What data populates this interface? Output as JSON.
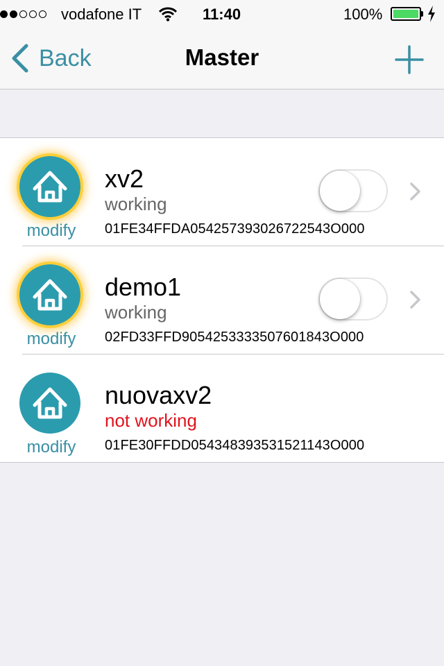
{
  "status_bar": {
    "signal_dots": [
      true,
      true,
      false,
      false,
      false
    ],
    "carrier": "vodafone IT",
    "time": "11:40",
    "battery": "100%"
  },
  "nav": {
    "back_label": "Back",
    "title": "Master"
  },
  "colors": {
    "accent": "#3a8fa3",
    "avatar": "#2b9cae",
    "error": "#e0141e",
    "glow": "#ffcf3a"
  },
  "devices": [
    {
      "name": "xv2",
      "status": "working",
      "serial": "01FE34FFDA054257393026722543O000",
      "modify_label": "modify",
      "icon": "home-icon",
      "highlighted": true,
      "toggle_on": false,
      "has_toggle": true
    },
    {
      "name": "demo1",
      "status": "working",
      "serial": "02FD33FFD9054253333507601843O000",
      "modify_label": "modify",
      "icon": "home-icon",
      "highlighted": true,
      "toggle_on": false,
      "has_toggle": true
    },
    {
      "name": "nuovaxv2",
      "status": "not working",
      "serial": "01FE30FFDD054348393531521143O000",
      "modify_label": "modify",
      "icon": "home-icon",
      "highlighted": false,
      "toggle_on": false,
      "has_toggle": false
    }
  ]
}
